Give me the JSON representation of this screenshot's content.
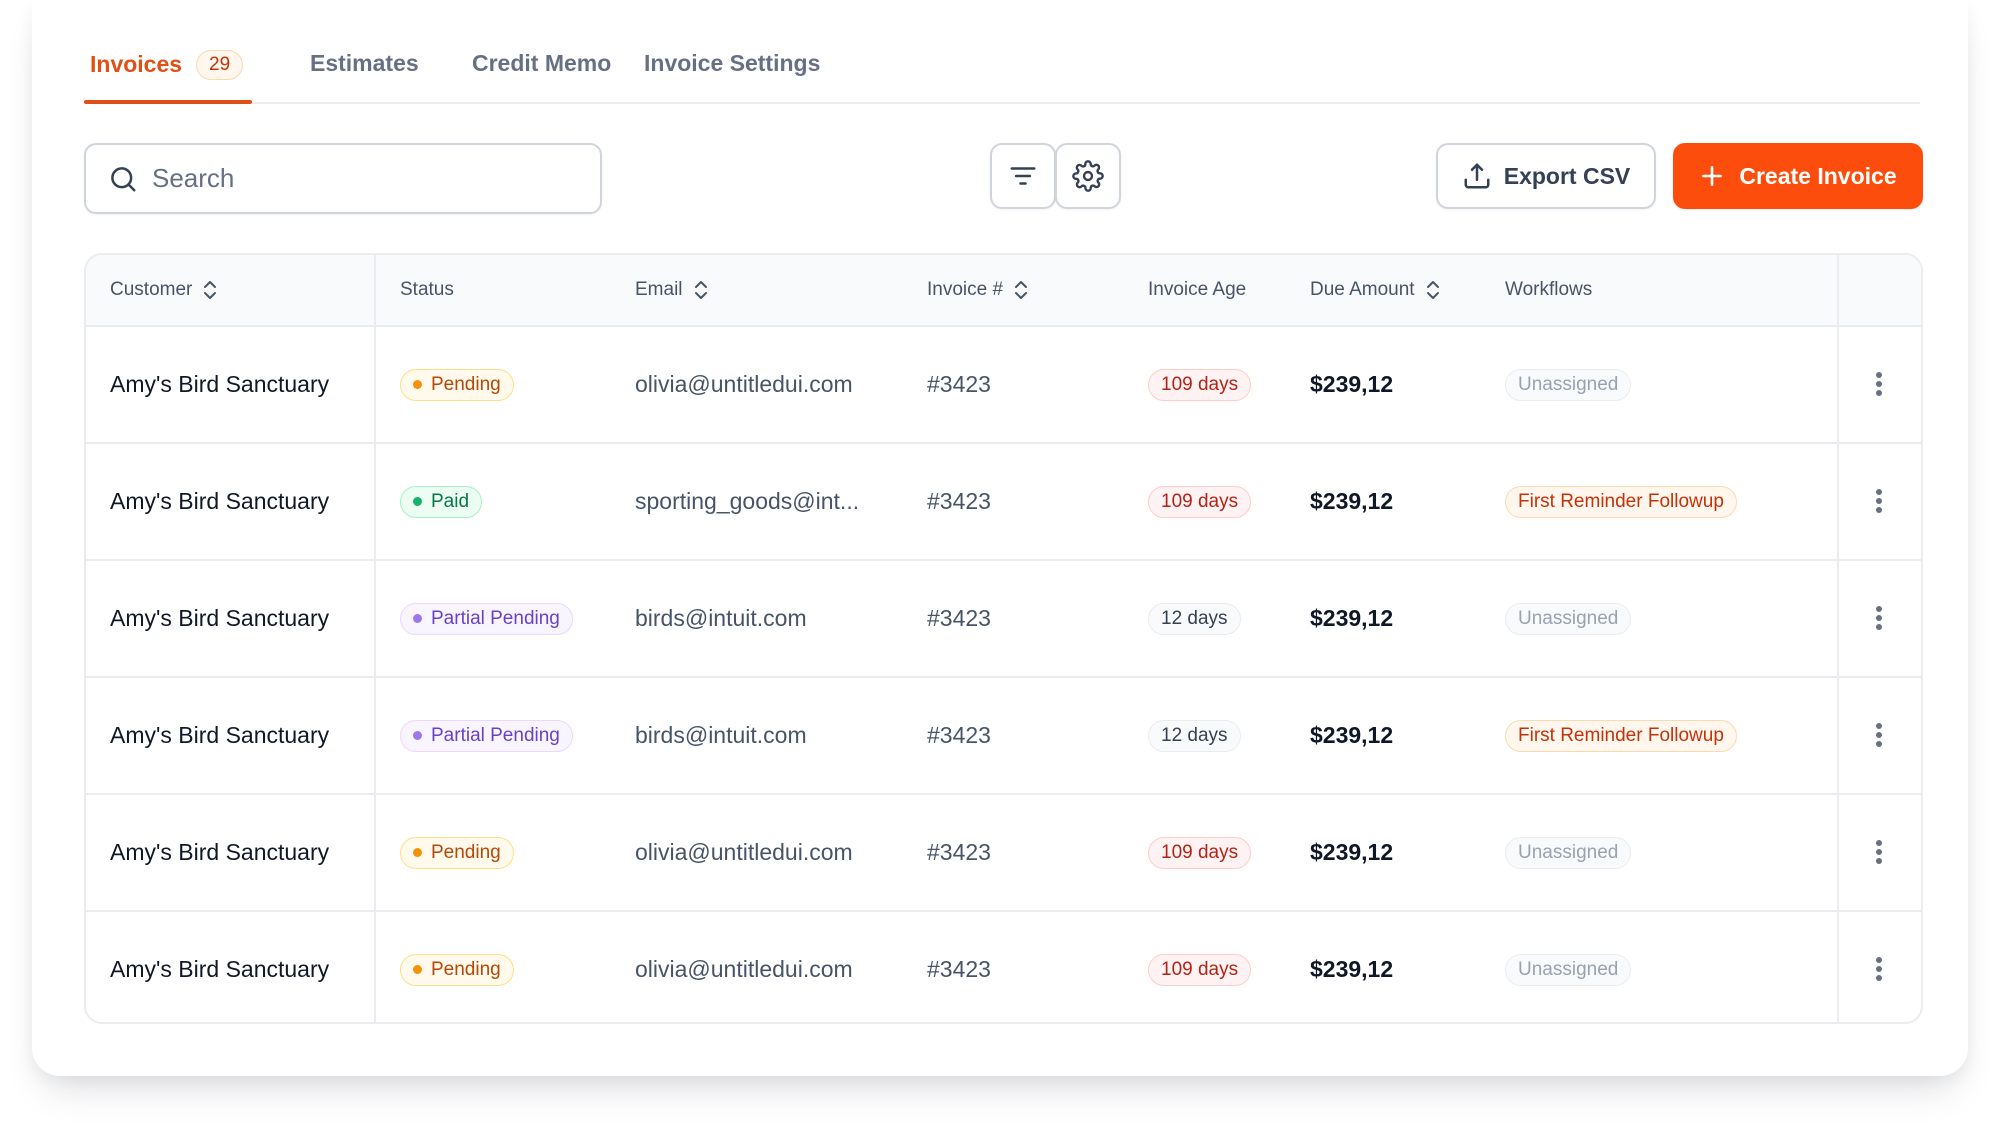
{
  "tabs": [
    {
      "label": "Invoices",
      "count": "29",
      "active": true
    },
    {
      "label": "Estimates",
      "active": false
    },
    {
      "label": "Credit Memo",
      "active": false
    },
    {
      "label": "Invoice Settings",
      "active": false
    }
  ],
  "toolbar": {
    "search_placeholder": "Search",
    "search_value": "",
    "filter_icon": "filter-lines-icon",
    "settings_icon": "gear-icon",
    "export_label": "Export CSV",
    "export_icon": "upload-icon",
    "create_label": "Create Invoice",
    "create_icon": "plus-icon"
  },
  "table": {
    "columns": [
      {
        "label": "Customer",
        "sortable": true
      },
      {
        "label": "Status",
        "sortable": false
      },
      {
        "label": "Email",
        "sortable": true
      },
      {
        "label": "Invoice #",
        "sortable": true
      },
      {
        "label": "Invoice Age",
        "sortable": false
      },
      {
        "label": "Due Amount",
        "sortable": true
      },
      {
        "label": "Workflows",
        "sortable": false
      }
    ],
    "rows": [
      {
        "customer": "Amy's Bird Sanctuary",
        "status": "Pending",
        "status_kind": "pending",
        "email": "olivia@untitledui.com",
        "invoice": "#3423",
        "age": "109 days",
        "age_kind": "red",
        "amount": "$239,12",
        "workflow": "Unassigned",
        "workflow_kind": "none"
      },
      {
        "customer": "Amy's Bird Sanctuary",
        "status": "Paid",
        "status_kind": "paid",
        "email": "sporting_goods@int...",
        "invoice": "#3423",
        "age": "109 days",
        "age_kind": "red",
        "amount": "$239,12",
        "workflow": "First Reminder Followup",
        "workflow_kind": "orange"
      },
      {
        "customer": "Amy's Bird Sanctuary",
        "status": "Partial Pending",
        "status_kind": "partial",
        "email": "birds@intuit.com",
        "invoice": "#3423",
        "age": "12 days",
        "age_kind": "gray",
        "amount": "$239,12",
        "workflow": "Unassigned",
        "workflow_kind": "none"
      },
      {
        "customer": "Amy's Bird Sanctuary",
        "status": "Partial Pending",
        "status_kind": "partial",
        "email": "birds@intuit.com",
        "invoice": "#3423",
        "age": "12 days",
        "age_kind": "gray",
        "amount": "$239,12",
        "workflow": "First Reminder Followup",
        "workflow_kind": "orange"
      },
      {
        "customer": "Amy's Bird Sanctuary",
        "status": "Pending",
        "status_kind": "pending",
        "email": "olivia@untitledui.com",
        "invoice": "#3423",
        "age": "109 days",
        "age_kind": "red",
        "amount": "$239,12",
        "workflow": "Unassigned",
        "workflow_kind": "none"
      },
      {
        "customer": "Amy's Bird Sanctuary",
        "status": "Pending",
        "status_kind": "pending",
        "email": "olivia@untitledui.com",
        "invoice": "#3423",
        "age": "109 days",
        "age_kind": "red",
        "amount": "$239,12",
        "workflow": "Unassigned",
        "workflow_kind": "none"
      }
    ]
  },
  "colors": {
    "accent": "#fd4d0d",
    "tab_active": "#e04f16",
    "border": "#eaecf0"
  }
}
